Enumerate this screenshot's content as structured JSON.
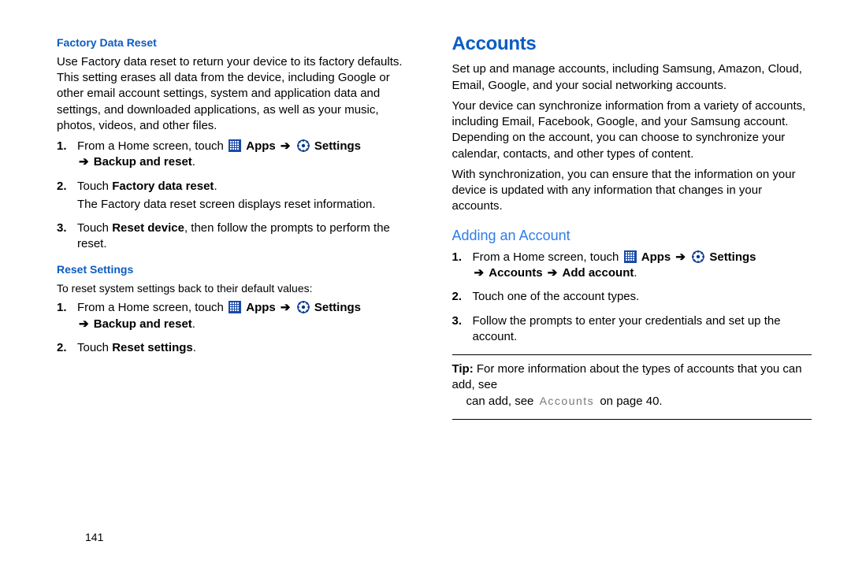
{
  "pageNumber": "141",
  "arrow": "➔",
  "left": {
    "factoryReset": {
      "heading": "Factory Data Reset",
      "intro": "Use Factory data reset to return your device to its factory defaults. This setting erases all data from the device, including Google or other email account settings, system and application data and settings, and downloaded applications, as well as your music, photos, videos, and other files.",
      "step1_pre": "From a Home screen, touch ",
      "step1_apps": "Apps",
      "step1_settings": "Settings",
      "step1_dest": "Backup and reset",
      "step2_pre": "Touch ",
      "step2_bold": "Factory data reset",
      "step2_sub": "The Factory data reset screen displays reset information.",
      "step3_pre": "Touch ",
      "step3_bold": "Reset device",
      "step3_post": ", then follow the prompts to perform the reset."
    },
    "resetSettings": {
      "heading": "Reset Settings",
      "intro": "To reset system settings back to their default values:",
      "step1_pre": "From a Home screen, touch ",
      "step1_apps": "Apps",
      "step1_settings": "Settings",
      "step1_dest": "Backup and reset",
      "step2_pre": "Touch ",
      "step2_bold": "Reset settings"
    }
  },
  "right": {
    "accounts": {
      "heading": "Accounts",
      "p1": "Set up and manage accounts, including Samsung, Amazon, Cloud, Email, Google, and your social networking accounts.",
      "p2": "Your device can synchronize information from a variety of accounts, including Email, Facebook, Google, and your Samsung account. Depending on the account, you can choose to synchronize your calendar, contacts, and other types of content.",
      "p3": "With synchronization, you can ensure that the information on your device is updated with any information that changes in your accounts."
    },
    "adding": {
      "heading": "Adding an Account",
      "step1_pre": "From a Home screen, touch ",
      "step1_apps": "Apps",
      "step1_settings": "Settings",
      "step1_dest1": "Accounts",
      "step1_dest2": "Add account",
      "step2": "Touch one of the account types.",
      "step3": "Follow the prompts to enter your credentials and set up the account."
    },
    "tip": {
      "label": "Tip:",
      "text1": " For more information about the types of accounts that you can add, see ",
      "ref": "\"Accounts\"",
      "text2": " on page 40."
    }
  }
}
